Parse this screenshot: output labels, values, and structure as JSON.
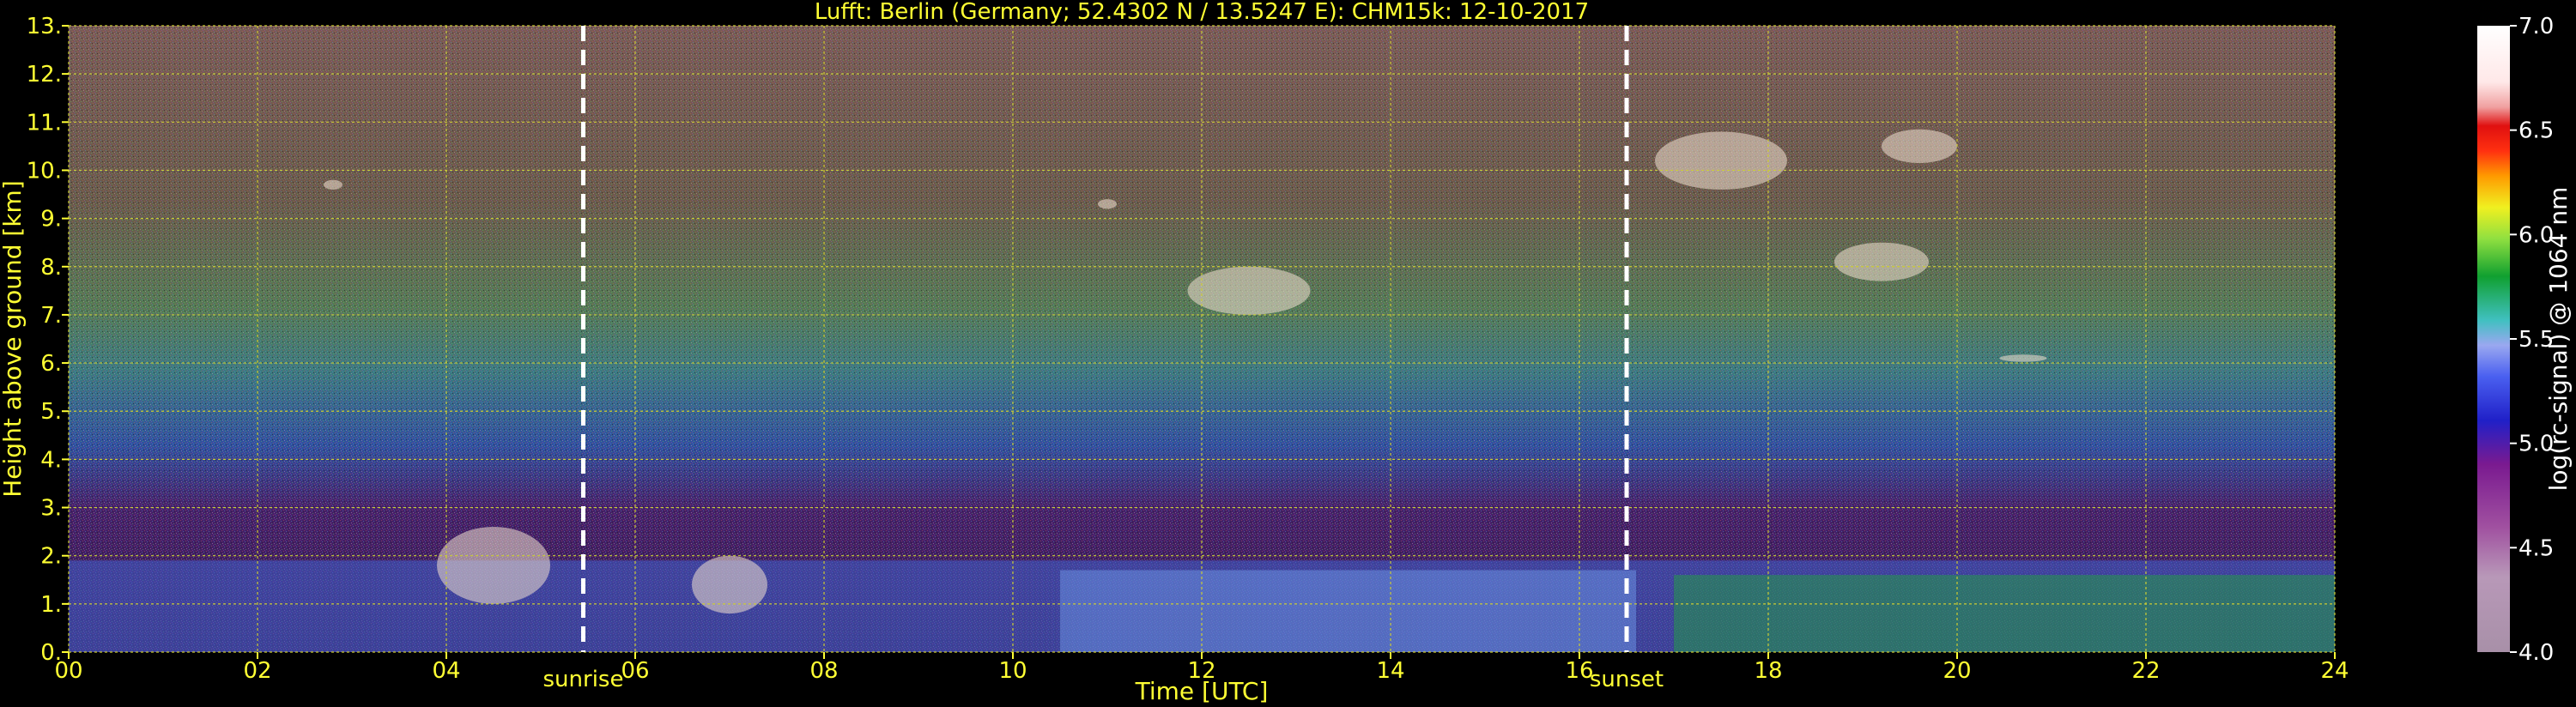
{
  "chart_data": {
    "type": "heatmap",
    "title": "Lufft: Berlin (Germany; 52.4302 N / 13.5247 E):    CHM15k: 12-10-2017",
    "xlabel": "Time [UTC]",
    "ylabel": "Height above ground [km]",
    "colorbar_label": "log(rc-signal) @ 1064 nm",
    "xlim": [
      0,
      24
    ],
    "ylim": [
      0,
      13
    ],
    "xticks": [
      "00",
      "02",
      "04",
      "06",
      "08",
      "10",
      "12",
      "14",
      "16",
      "18",
      "20",
      "22",
      "24"
    ],
    "yticks": [
      "0.",
      "1.",
      "2.",
      "3.",
      "4.",
      "5.",
      "6.",
      "7.",
      "8.",
      "9.",
      "10.",
      "11.",
      "12.",
      "13."
    ],
    "colorbar_range": [
      4.0,
      7.0
    ],
    "colorbar_ticks": [
      "4.0",
      "4.5",
      "5.0",
      "5.5",
      "6.0",
      "6.5",
      "7.0"
    ],
    "grid": true,
    "annotations": [
      {
        "text": "sunrise",
        "x": 5.45
      },
      {
        "text": "sunset",
        "x": 16.5
      }
    ],
    "colors": {
      "text": "#ffff33",
      "background": "#000000",
      "grid": "#cccc33",
      "marker_line": "#ffffff"
    }
  }
}
